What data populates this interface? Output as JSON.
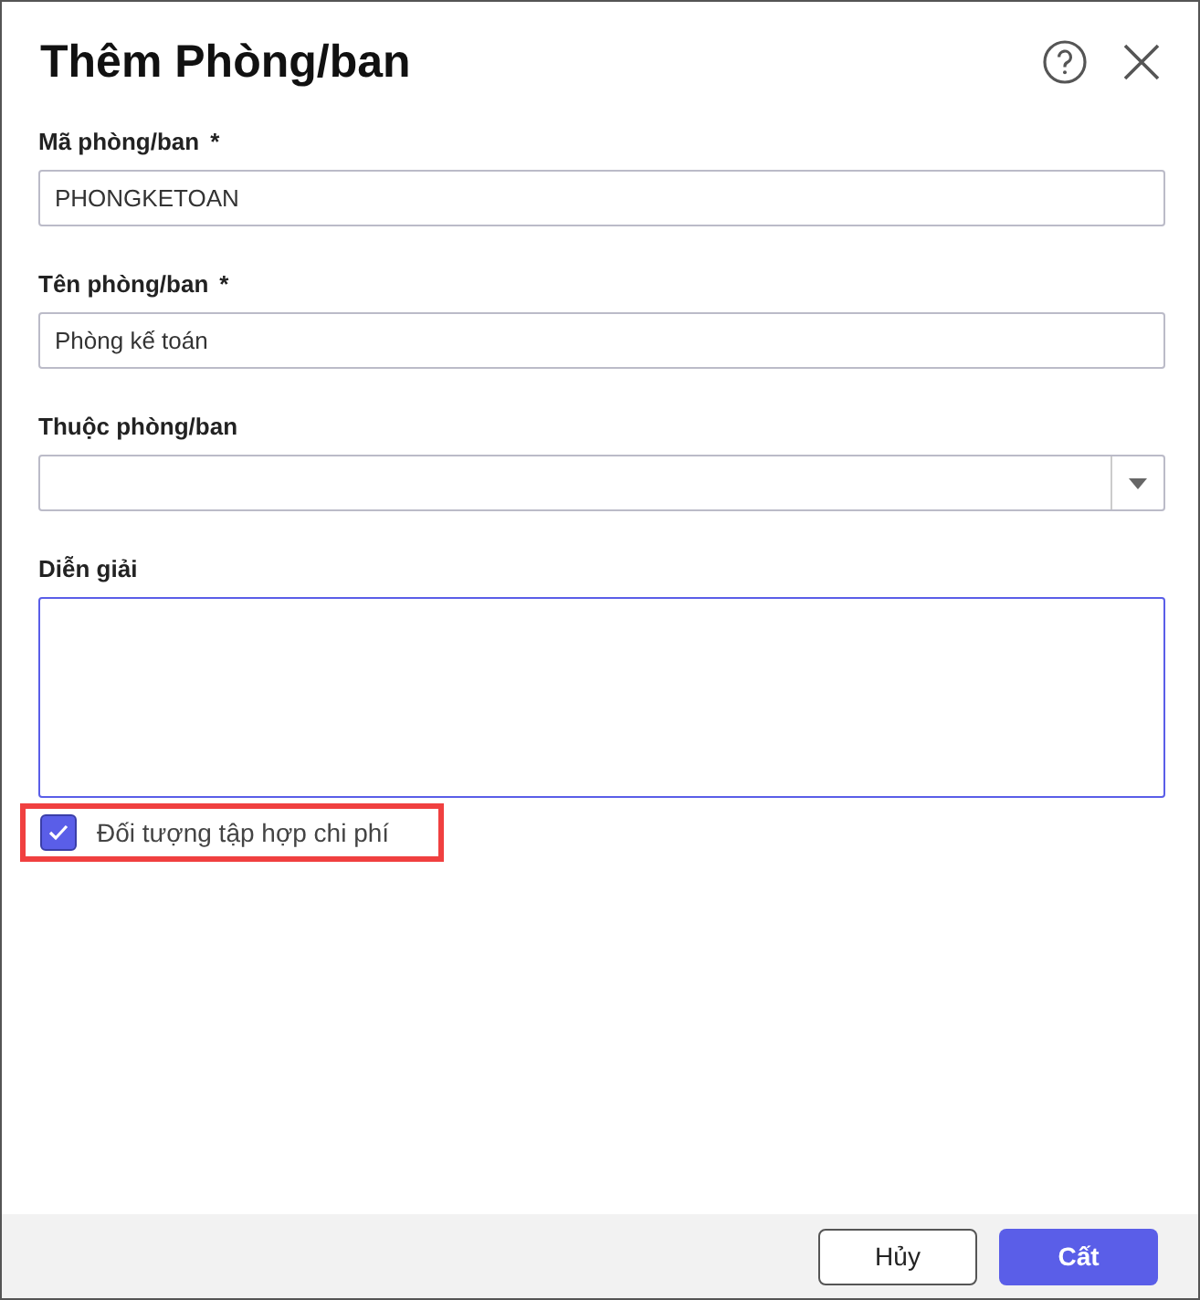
{
  "dialog": {
    "title": "Thêm Phòng/ban"
  },
  "fields": [
    {
      "kind": "text",
      "label": "Mã phòng/ban",
      "required_mark": "*",
      "value": "PHONGKETOAN"
    },
    {
      "kind": "text",
      "label": "Tên phòng/ban",
      "required_mark": "*",
      "value": "Phòng kế toán"
    },
    {
      "kind": "select",
      "label": "Thuộc phòng/ban"
    },
    {
      "kind": "textarea",
      "label": "Diễn giải",
      "focused": true
    }
  ],
  "checkbox": {
    "label": "Đối tượng tập hợp chi phí",
    "checked": true,
    "highlighted": true
  },
  "buttons": [
    {
      "label": "Hủy",
      "kind": "secondary"
    },
    {
      "label": "Cất",
      "kind": "primary"
    }
  ]
}
